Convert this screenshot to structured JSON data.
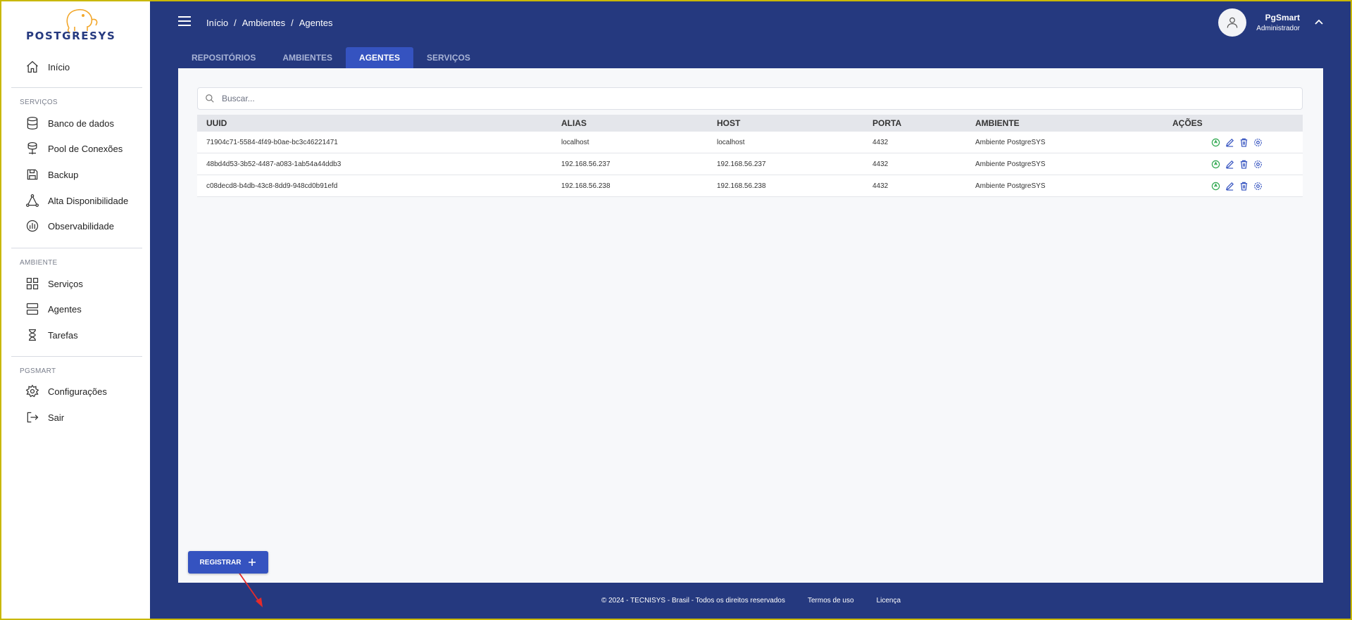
{
  "brand": {
    "logo_text": "POSTGRESYS",
    "primary_color": "#25397f",
    "accent_color": "#3553c0",
    "logo_color": "#f2a72b"
  },
  "sidebar": {
    "home_label": "Início",
    "sections": [
      {
        "title": "SERVIÇOS",
        "items": [
          {
            "label": "Banco de dados",
            "icon": "database-icon"
          },
          {
            "label": "Pool de Conexões",
            "icon": "pool-icon"
          },
          {
            "label": "Backup",
            "icon": "save-icon"
          },
          {
            "label": "Alta Disponibilidade",
            "icon": "network-icon"
          },
          {
            "label": "Observabilidade",
            "icon": "pie-chart-icon"
          }
        ]
      },
      {
        "title": "AMBIENTE",
        "items": [
          {
            "label": "Serviços",
            "icon": "grid-icon"
          },
          {
            "label": "Agentes",
            "icon": "server-icon"
          },
          {
            "label": "Tarefas",
            "icon": "hourglass-icon"
          }
        ]
      },
      {
        "title": "PGSMART",
        "items": [
          {
            "label": "Configurações",
            "icon": "gear-icon"
          },
          {
            "label": "Sair",
            "icon": "logout-icon"
          }
        ]
      }
    ]
  },
  "header": {
    "breadcrumb": [
      "Início",
      "/",
      "Ambientes",
      "/",
      "Agentes"
    ],
    "user": {
      "name": "PgSmart",
      "role": "Administrador"
    }
  },
  "tabs": [
    {
      "label": "REPOSITÓRIOS",
      "active": false
    },
    {
      "label": "AMBIENTES",
      "active": false
    },
    {
      "label": "AGENTES",
      "active": true
    },
    {
      "label": "SERVIÇOS",
      "active": false
    }
  ],
  "search": {
    "placeholder": "Buscar...",
    "value": ""
  },
  "table": {
    "columns": [
      "UUID",
      "ALIAS",
      "HOST",
      "PORTA",
      "AMBIENTE",
      "AÇÕES"
    ],
    "rows": [
      [
        "71904c71-5584-4f49-b0ae-bc3c46221471",
        "localhost",
        "localhost",
        "4432",
        "Ambiente PostgreSYS"
      ],
      [
        "48bd4d53-3b52-4487-a083-1ab54a44ddb3",
        "192.168.56.237",
        "192.168.56.237",
        "4432",
        "Ambiente PostgreSYS"
      ],
      [
        "c08decd8-b4db-43c8-8dd9-948cd0b91efd",
        "192.168.56.238",
        "192.168.56.238",
        "4432",
        "Ambiente PostgreSYS"
      ]
    ]
  },
  "actions": {
    "register_label": "REGISTRAR"
  },
  "footer": {
    "copyright": "© 2024 - TECNISYS - Brasil - Todos os direitos reservados",
    "terms": "Termos de uso",
    "license": "Licença"
  }
}
